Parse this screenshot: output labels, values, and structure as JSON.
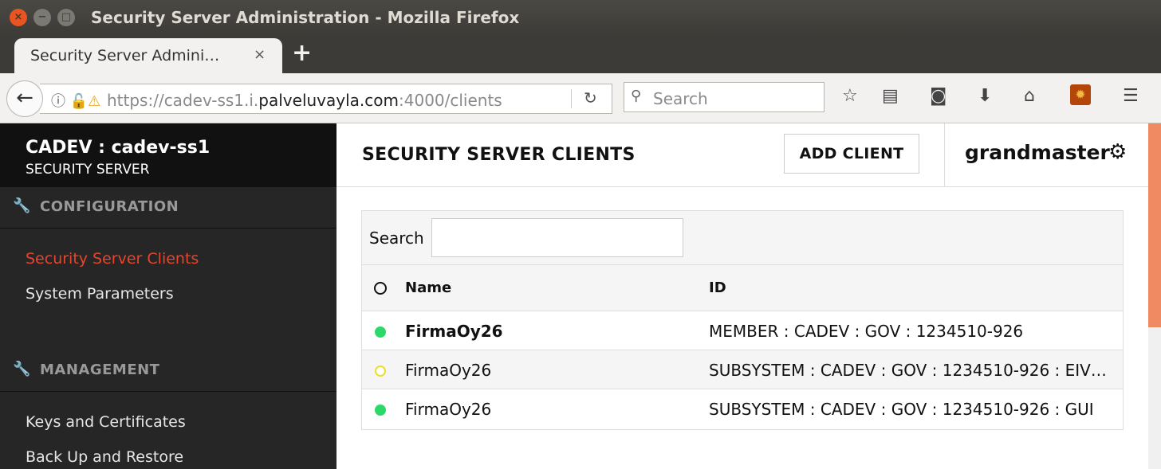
{
  "window": {
    "title": "Security Server Administration - Mozilla Firefox",
    "buttons": {
      "close": "×",
      "minimize": "−",
      "maximize": "□"
    }
  },
  "tab": {
    "label": "Security Server Admini…",
    "close": "×",
    "new_tab": "+"
  },
  "navbar": {
    "url_prefix": "https://cadev-ss1.i.",
    "url_domain": "palveluvayla.com",
    "url_suffix": ":4000/clients",
    "search_placeholder": "Search"
  },
  "sidebar": {
    "server_title": "CADEV : cadev-ss1",
    "server_subtitle": "SECURITY SERVER",
    "sections": [
      {
        "label": "CONFIGURATION",
        "items": [
          "Security Server Clients",
          "System Parameters"
        ]
      },
      {
        "label": "MANAGEMENT",
        "items": [
          "Keys and Certificates",
          "Back Up and Restore"
        ]
      }
    ],
    "active_item": "Security Server Clients"
  },
  "main": {
    "page_title": "SECURITY SERVER CLIENTS",
    "add_client_label": "ADD CLIENT",
    "username": "grandmaster",
    "search_label": "Search",
    "search_value": "",
    "columns": [
      "Name",
      "ID"
    ],
    "rows": [
      {
        "status": "green",
        "name": "FirmaOy26",
        "id": "MEMBER : CADEV : GOV : 1234510-926",
        "bold": true
      },
      {
        "status": "yellow",
        "name": "FirmaOy26",
        "id": "SUBSYSTEM : CADEV : GOV : 1234510-926 : EIV…",
        "bold": false
      },
      {
        "status": "green",
        "name": "FirmaOy26",
        "id": "SUBSYSTEM : CADEV : GOV : 1234510-926 : GUI",
        "bold": false
      }
    ]
  },
  "colors": {
    "accent": "#e8452c",
    "status_green": "#2cd86a",
    "status_yellow": "#e8e02a",
    "sidebar_bg": "#262626"
  }
}
